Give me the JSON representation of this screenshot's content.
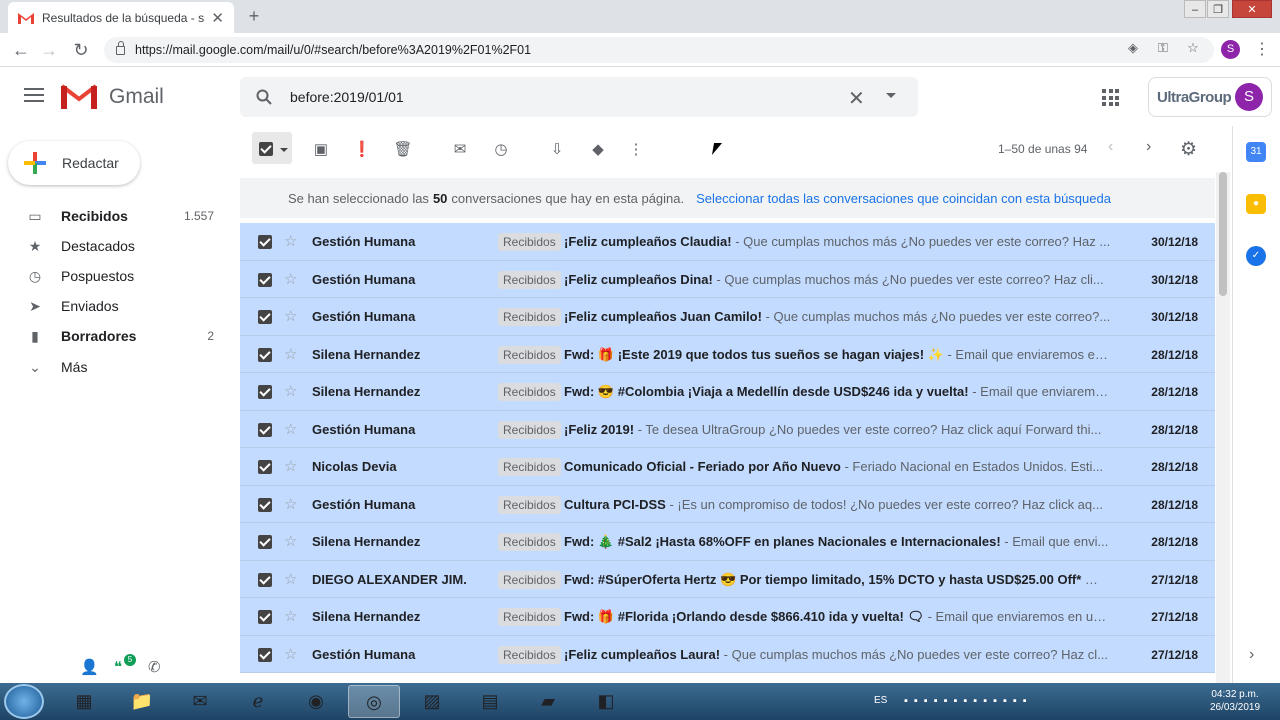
{
  "browser": {
    "tab_title": "Resultados de la búsqueda - sm",
    "url": "https://mail.google.com/mail/u/0/#search/before%3A2019%2F01%2F01",
    "profile_initial": "S"
  },
  "header": {
    "app_name": "Gmail",
    "search_query": "before:2019/01/01",
    "org_name": "UltraGroup",
    "avatar_initial": "S"
  },
  "sidebar": {
    "compose_label": "Redactar",
    "items": [
      {
        "label": "Recibidos",
        "count": "1.557",
        "bold": true,
        "icon": "inbox-icon"
      },
      {
        "label": "Destacados",
        "count": "",
        "bold": false,
        "icon": "star-icon"
      },
      {
        "label": "Pospuestos",
        "count": "",
        "bold": false,
        "icon": "clock-icon"
      },
      {
        "label": "Enviados",
        "count": "",
        "bold": false,
        "icon": "send-icon"
      },
      {
        "label": "Borradores",
        "count": "2",
        "bold": true,
        "icon": "draft-icon"
      },
      {
        "label": "Más",
        "count": "",
        "bold": false,
        "icon": "chevron-down-icon"
      }
    ],
    "hangouts_badge": "5"
  },
  "toolbar": {
    "pager_text": "1–50 de unas 94"
  },
  "banner": {
    "prefix": "Se han seleccionado las",
    "count": "50",
    "suffix": "conversaciones que hay en esta página.",
    "link": "Seleccionar todas las conversaciones que coincidan con esta búsqueda"
  },
  "emails": [
    {
      "sender": "Gestión Humana",
      "label": "Recibidos",
      "subject": "¡Feliz cumpleaños Claudia!",
      "snippet": " - Que cumplas muchos más ¿No puedes ver este correo? Haz ...",
      "date": "30/12/18"
    },
    {
      "sender": "Gestión Humana",
      "label": "Recibidos",
      "subject": "¡Feliz cumpleaños Dina!",
      "snippet": " - Que cumplas muchos más ¿No puedes ver este correo? Haz cli...",
      "date": "30/12/18"
    },
    {
      "sender": "Gestión Humana",
      "label": "Recibidos",
      "subject": "¡Feliz cumpleaños Juan Camilo!",
      "snippet": " - Que cumplas muchos más ¿No puedes ver este correo?...",
      "date": "30/12/18"
    },
    {
      "sender": "Silena Hernandez",
      "label": "Recibidos",
      "subject": "Fwd: 🎁 ¡Este 2019 que todos tus sueños se hagan viajes! ✨",
      "snippet": " - Email que enviaremos en l...",
      "date": "28/12/18"
    },
    {
      "sender": "Silena Hernandez",
      "label": "Recibidos",
      "subject": "Fwd: 😎 #Colombia ¡Viaja a Medellín desde USD$246 ida y vuelta!",
      "snippet": " - Email que enviaremo...",
      "date": "28/12/18"
    },
    {
      "sender": "Gestión Humana",
      "label": "Recibidos",
      "subject": "¡Feliz 2019!",
      "snippet": " - Te desea UltraGroup ¿No puedes ver este correo? Haz click aquí Forward thi...",
      "date": "28/12/18"
    },
    {
      "sender": "Nicolas Devia",
      "label": "Recibidos",
      "subject": "Comunicado Oficial - Feriado por Año Nuevo",
      "snippet": " - Feriado Nacional en Estados Unidos. Esti...",
      "date": "28/12/18"
    },
    {
      "sender": "Gestión Humana",
      "label": "Recibidos",
      "subject": "Cultura PCI-DSS",
      "snippet": " - ¡Es un compromiso de todos! ¿No puedes ver este correo? Haz click aq...",
      "date": "28/12/18"
    },
    {
      "sender": "Silena Hernandez",
      "label": "Recibidos",
      "subject": "Fwd: 🎄 #Sal2 ¡Hasta 68%OFF en planes Nacionales e Internacionales!",
      "snippet": " - Email que envi...",
      "date": "28/12/18"
    },
    {
      "sender": "DIEGO ALEXANDER JIM.",
      "label": "Recibidos",
      "subject": "Fwd: #SúperOferta Hertz 😎 Por tiempo limitado, 15% DCTO y hasta USD$25.00 Off* 😲",
      "snippet": " - ...",
      "date": "27/12/18"
    },
    {
      "sender": "Silena Hernandez",
      "label": "Recibidos",
      "subject": "Fwd: 🎁 #Florida ¡Orlando desde $866.410 ida y vuelta! 🗨",
      "snippet": " - Email que enviaremos en un ...",
      "date": "27/12/18"
    },
    {
      "sender": "Gestión Humana",
      "label": "Recibidos",
      "subject": "¡Feliz cumpleaños Laura!",
      "snippet": " - Que cumplas muchos más ¿No puedes ver este correo? Haz cl...",
      "date": "27/12/18"
    }
  ],
  "taskbar": {
    "language": "ES",
    "time": "04:32 p.m.",
    "date": "26/03/2019"
  },
  "colors": {
    "selected_row": "#c2dbff",
    "link_blue": "#1a73e8",
    "gmail_red": "#ea4335",
    "avatar_purple": "#8e24aa"
  }
}
